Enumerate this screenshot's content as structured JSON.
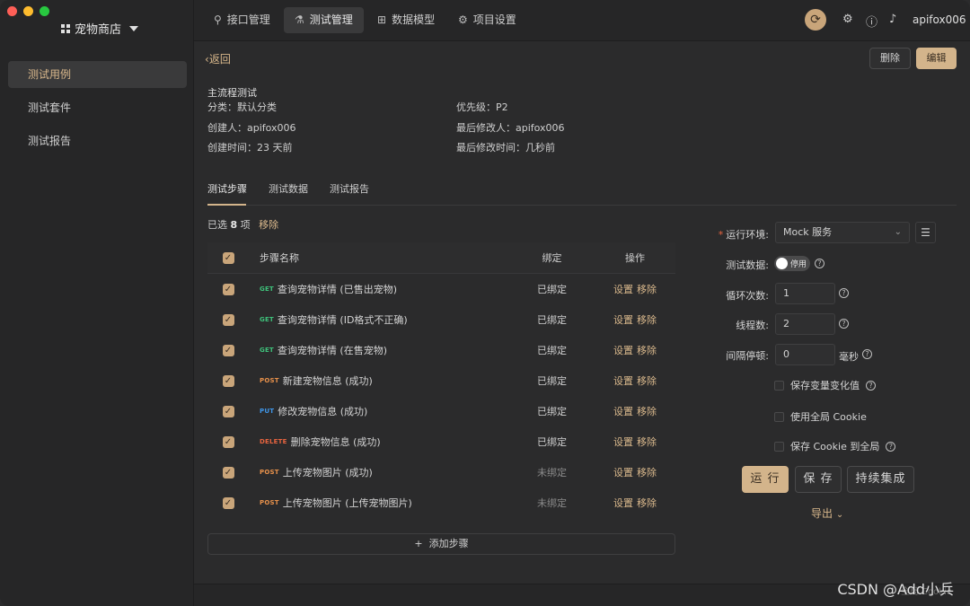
{
  "app": {
    "project_name": "宠物商店",
    "user": "apifox006"
  },
  "sidebar": {
    "items": [
      {
        "label": "测试用例"
      },
      {
        "label": "测试套件"
      },
      {
        "label": "测试报告"
      }
    ]
  },
  "topbar": {
    "tabs": [
      {
        "label": "接口管理",
        "icon": "link-icon"
      },
      {
        "label": "测试管理",
        "icon": "flask-icon"
      },
      {
        "label": "数据模型",
        "icon": "model-icon"
      },
      {
        "label": "项目设置",
        "icon": "gear-icon"
      }
    ]
  },
  "toolbar": {
    "back_label": "返回",
    "delete_label": "删除",
    "edit_label": "编辑"
  },
  "case": {
    "title": "主流程测试",
    "category": "分类：默认分类",
    "priority": "优先级：P2",
    "creator": "创建人：apifox006",
    "modifier": "最后修改人：apifox006",
    "created": "创建时间：23 天前",
    "modified": "最后修改时间：几秒前"
  },
  "subtabs": [
    {
      "label": "测试步骤"
    },
    {
      "label": "测试数据"
    },
    {
      "label": "测试报告"
    }
  ],
  "selection": {
    "prefix": "已选",
    "count": "8",
    "suffix": "项",
    "remove_label": "移除"
  },
  "table": {
    "headers": {
      "name": "步骤名称",
      "bind": "绑定",
      "ops": "操作"
    },
    "op_settings": "设置",
    "op_remove": "移除",
    "rows": [
      {
        "method": "GET",
        "name": "查询宠物详情 (已售出宠物)",
        "bind": "已绑定"
      },
      {
        "method": "GET",
        "name": "查询宠物详情 (ID格式不正确)",
        "bind": "已绑定"
      },
      {
        "method": "GET",
        "name": "查询宠物详情 (在售宠物)",
        "bind": "已绑定"
      },
      {
        "method": "POST",
        "name": "新建宠物信息 (成功)",
        "bind": "已绑定"
      },
      {
        "method": "PUT",
        "name": "修改宠物信息 (成功)",
        "bind": "已绑定"
      },
      {
        "method": "DELETE",
        "name": "删除宠物信息 (成功)",
        "bind": "已绑定"
      },
      {
        "method": "POST",
        "name": "上传宠物图片 (成功)",
        "bind": "未绑定"
      },
      {
        "method": "POST",
        "name": "上传宠物图片 (上传宠物图片)",
        "bind": "未绑定"
      }
    ],
    "add_step_label": "添加步骤"
  },
  "config": {
    "env_label": "运行环境:",
    "env_value": "Mock 服务",
    "test_data_label": "测试数据:",
    "test_data_toggle": "停用",
    "loop_label": "循环次数:",
    "loop_value": "1",
    "threads_label": "线程数:",
    "threads_value": "2",
    "interval_label": "间隔停顿:",
    "interval_value": "0",
    "interval_unit": "毫秒",
    "save_vars_label": "保存变量变化值",
    "global_cookie_label": "使用全局 Cookie",
    "save_cookie_label": "保存 Cookie 到全局",
    "run_label": "运 行",
    "save_label": "保 存",
    "ci_label": "持续集成",
    "export_label": "导出"
  },
  "watermark": {
    "text": "CSDN @Add小兵",
    "sub": "全局 Cookie"
  }
}
